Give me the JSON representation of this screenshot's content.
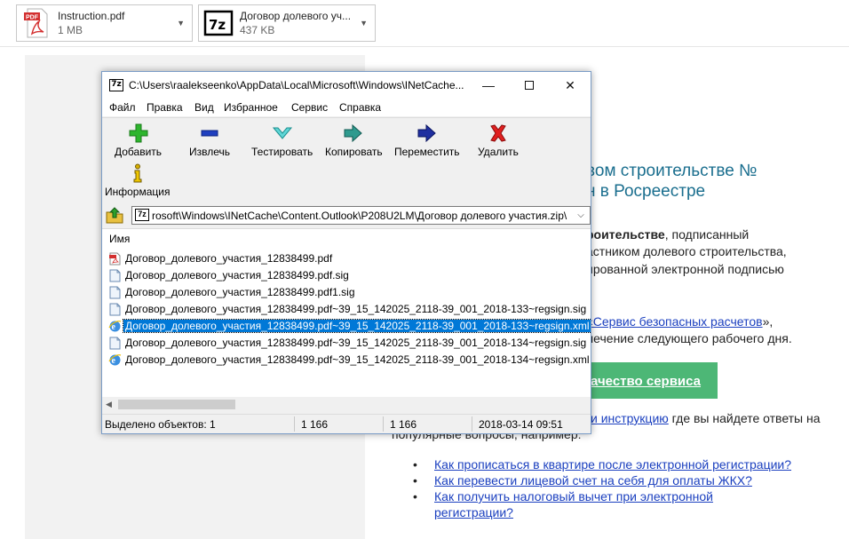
{
  "attachments": [
    {
      "name": "Instruction.pdf",
      "size": "1 MB",
      "icon": "pdf-file-icon"
    },
    {
      "name": "Договор долевого уч...",
      "size": "437 KB",
      "icon": "7zip-archive-icon"
    }
  ],
  "email": {
    "heading_line1": "вом строительстве №",
    "heading_line2": "н в Росреестре",
    "para1_bold": "роительстве",
    "para1_rest": ", подписанный",
    "para1_line2": "астником долевого строительства,",
    "para1_line3": "ированной электронной подписью",
    "link_service": "«Сервис безопасных расчетов",
    "link_service_after": "»,",
    "para2_line2": "лечение следующего рабочего дня.",
    "quality_button": "ачество сервиса",
    "link_instruction": "и инструкцию",
    "instruction_after": " где вы найдете ответы на",
    "faq_intro": "популярные вопросы, например:",
    "faq": [
      "Как прописаться в квартире после электронной регистрации?",
      "Как перевести лицевой счет на себя для оплаты ЖКХ?",
      "Как получить налоговый вычет при электронной",
      "регистрации?"
    ]
  },
  "window": {
    "title": "C:\\Users\\raalekseenko\\AppData\\Local\\Microsoft\\Windows\\INetCache...",
    "app_icon": "7z",
    "controls": {
      "minimize": "—",
      "close": "✕"
    },
    "menu": [
      "Файл",
      "Правка",
      "Вид",
      "Избранное",
      "Сервис",
      "Справка"
    ],
    "toolbar": [
      {
        "label": "Добавить",
        "icon": "add-plus-icon"
      },
      {
        "label": "Извлечь",
        "icon": "extract-minus-icon"
      },
      {
        "label": "Тестировать",
        "icon": "test-check-icon"
      },
      {
        "label": "Копировать",
        "icon": "copy-arrow-icon"
      },
      {
        "label": "Переместить",
        "icon": "move-arrow-icon"
      },
      {
        "label": "Удалить",
        "icon": "delete-x-icon"
      },
      {
        "label": "Информация",
        "icon": "info-icon"
      }
    ],
    "path": "rosoft\\Windows\\INetCache\\Content.Outlook\\P208U2LM\\Договор долевого участия.zip\\",
    "column_name": "Имя",
    "files": [
      {
        "name": "Договор_долевого_участия_12838499.pdf",
        "icon": "pdf-file-icon",
        "selected": false
      },
      {
        "name": "Договор_долевого_участия_12838499.pdf.sig",
        "icon": "generic-file-icon",
        "selected": false
      },
      {
        "name": "Договор_долевого_участия_12838499.pdf1.sig",
        "icon": "generic-file-icon",
        "selected": false
      },
      {
        "name": "Договор_долевого_участия_12838499.pdf~39_15_142025_2118-39_001_2018-133~regsign.sig",
        "icon": "generic-file-icon",
        "selected": false
      },
      {
        "name": "Договор_долевого_участия_12838499.pdf~39_15_142025_2118-39_001_2018-133~regsign.xml",
        "icon": "ie-xml-icon",
        "selected": true
      },
      {
        "name": "Договор_долевого_участия_12838499.pdf~39_15_142025_2118-39_001_2018-134~regsign.sig",
        "icon": "generic-file-icon",
        "selected": false
      },
      {
        "name": "Договор_долевого_участия_12838499.pdf~39_15_142025_2118-39_001_2018-134~regsign.xml",
        "icon": "ie-xml-icon",
        "selected": false
      }
    ],
    "status": {
      "selected": "Выделено объектов: 1",
      "size": "1 166",
      "packed": "1 166",
      "modified": "2018-03-14 09:51"
    }
  }
}
